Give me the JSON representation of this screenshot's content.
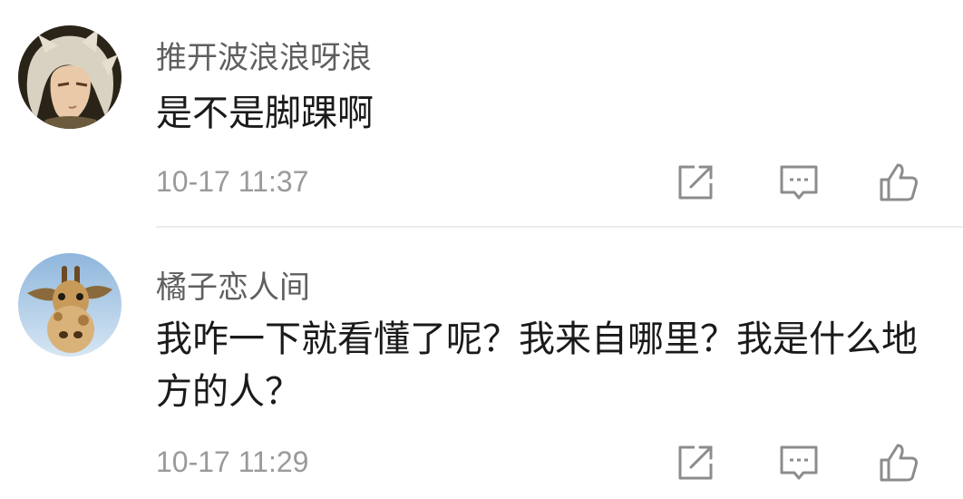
{
  "comments": [
    {
      "username": "推开波浪浪呀浪",
      "text": "是不是脚踝啊",
      "timestamp": "10-17 11:37",
      "avatar_icon": "anime-character-avatar-icon"
    },
    {
      "username": "橘子恋人间",
      "text": "我咋一下就看懂了呢？我来自哪里？我是什么地方的人？",
      "timestamp": "10-17 11:29",
      "avatar_icon": "giraffe-avatar-icon"
    }
  ],
  "actions": {
    "share_icon": "share-icon",
    "reply_icon": "reply-comment-icon",
    "like_icon": "thumbs-up-icon"
  },
  "colors": {
    "username": "#5f5f5f",
    "text": "#1a1a1a",
    "timestamp": "#9a9a9a",
    "icon": "#8c8c8c",
    "divider": "#ececec"
  }
}
